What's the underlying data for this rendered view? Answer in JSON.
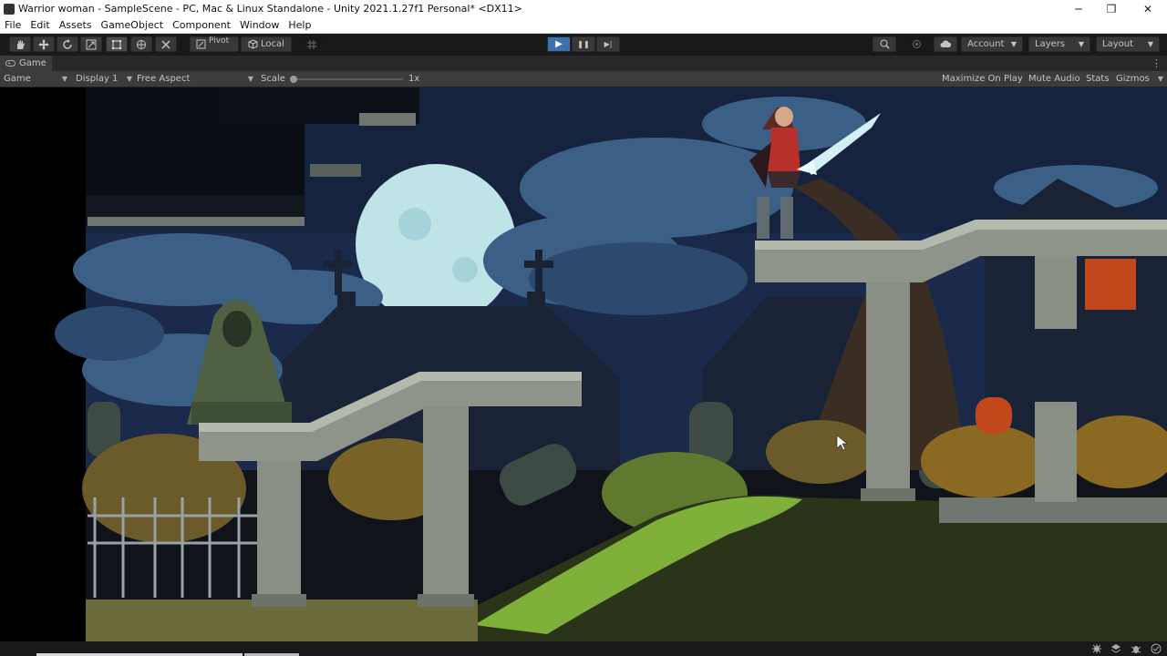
{
  "window": {
    "title": "Warrior woman - SampleScene - PC, Mac & Linux Standalone - Unity 2021.1.27f1 Personal* <DX11>",
    "controls": {
      "minimize": "─",
      "maximize": "❐",
      "close": "✕"
    }
  },
  "menu": [
    "File",
    "Edit",
    "Assets",
    "GameObject",
    "Component",
    "Window",
    "Help"
  ],
  "toolbar": {
    "tools": [
      "hand-icon",
      "move-icon",
      "rotate-icon",
      "scale-icon",
      "rect-icon",
      "transform-icon",
      "custom-tool-icon"
    ],
    "pivot_label": "Pivot",
    "local_label": "Local",
    "grid_icon": "grid-snap-icon",
    "play_icon": "▶",
    "pause_icon": "❚❚",
    "step_icon": "▶|",
    "search_icon": "search-icon",
    "collab_icon": "collab-icon",
    "cloud_icon": "cloud-icon",
    "account_label": "Account",
    "layers_label": "Layers",
    "layout_label": "Layout"
  },
  "tab": {
    "label": "Game",
    "menu_icon": "⋮"
  },
  "gamebar": {
    "view_select": "Game",
    "display_select": "Display 1",
    "aspect_select": "Free Aspect",
    "scale_label": "Scale",
    "scale_value": "1x",
    "maximize_on_play": "Maximize On Play",
    "mute_audio": "Mute Audio",
    "stats": "Stats",
    "gizmos": "Gizmos"
  },
  "colors": {
    "sky": "#1b2a4a",
    "moon": "#bfe4e8",
    "stone": "#8e9489",
    "grass": "#7fb03a",
    "accent": "#3a72b0"
  },
  "scene_objects": [
    "moon",
    "cloud",
    "church-silhouette",
    "grave-cross",
    "hooded-statue",
    "stone-bridge",
    "stone-pillar",
    "iron-fence",
    "tombstone",
    "grassy-hill",
    "dead-tree",
    "warrior-woman",
    "sword"
  ]
}
